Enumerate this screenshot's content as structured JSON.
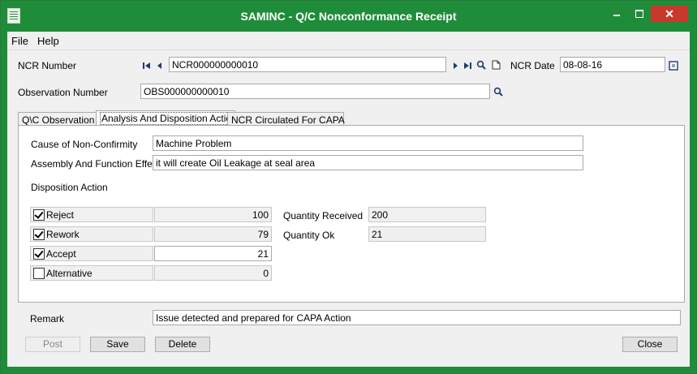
{
  "window": {
    "title": "SAMINC - Q/C Nonconformance Receipt",
    "close_glyph": "✕"
  },
  "menu": {
    "items": [
      "File",
      "Help"
    ]
  },
  "header": {
    "ncr_number_label": "NCR Number",
    "ncr_number_value": "NCR000000000010",
    "ncr_date_label": "NCR Date",
    "ncr_date_value": "08-08-16",
    "observation_label": "Observation Number",
    "observation_value": "OBS000000000010"
  },
  "tabs": [
    {
      "label": "Q\\C Observation"
    },
    {
      "label": "Analysis And Disposition Action"
    },
    {
      "label": "NCR Circulated For CAPA"
    }
  ],
  "analysis": {
    "cause_label": "Cause of Non-Confirmity",
    "cause_value": "Machine Problem",
    "effect_label": "Assembly And Function Effect",
    "effect_value": "it will create Oil Leakage at seal area",
    "disposition_label": "Disposition Action",
    "actions": [
      {
        "label": "Reject",
        "checked": true,
        "qty": "100"
      },
      {
        "label": "Rework",
        "checked": true,
        "qty": "79"
      },
      {
        "label": "Accept",
        "checked": true,
        "qty": "21"
      },
      {
        "label": "Alternative",
        "checked": false,
        "qty": "0"
      }
    ],
    "qty_received_label": "Quantity Received",
    "qty_received_value": "200",
    "qty_ok_label": "Quantity Ok",
    "qty_ok_value": "21"
  },
  "remark": {
    "label": "Remark",
    "value": "Issue detected and prepared for CAPA Action"
  },
  "buttons": {
    "post": "Post",
    "save": "Save",
    "delete": "Delete",
    "close": "Close"
  }
}
